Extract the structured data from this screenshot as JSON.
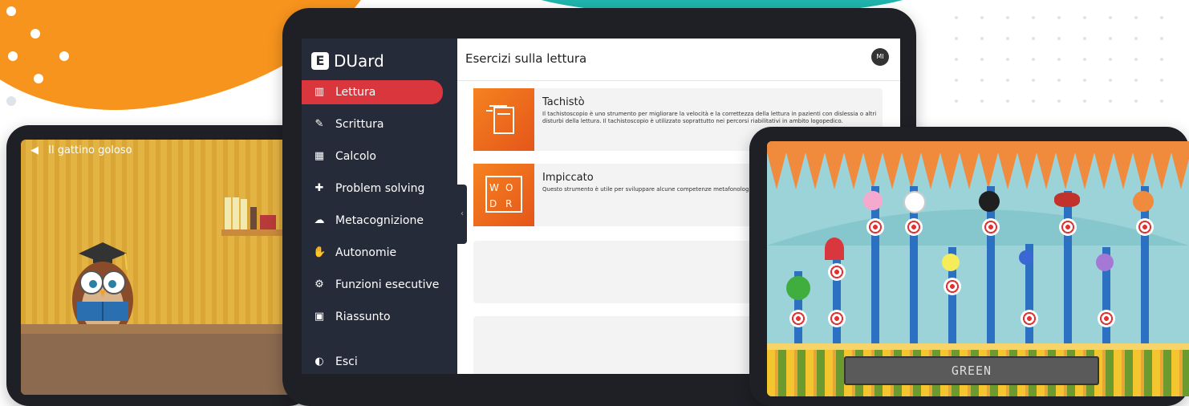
{
  "left_game": {
    "title": "Il gattino goloso",
    "back_icon": "triangle-left-icon"
  },
  "app": {
    "brand": "DUard",
    "brand_mark": "E",
    "page_title": "Esercizi sulla lettura",
    "avatar_initials": "MI",
    "accent": "#d9363e",
    "sidebar_bg": "#262b39"
  },
  "nav": [
    {
      "label": "Lettura",
      "icon": "book-open-icon",
      "active": true
    },
    {
      "label": "Scrittura",
      "icon": "pen-icon"
    },
    {
      "label": "Calcolo",
      "icon": "calculator-icon"
    },
    {
      "label": "Problem solving",
      "icon": "puzzle-icon"
    },
    {
      "label": "Metacognizione",
      "icon": "brain-icon"
    },
    {
      "label": "Autonomie",
      "icon": "hand-icon"
    },
    {
      "label": "Funzioni esecutive",
      "icon": "gears-icon"
    },
    {
      "label": "Riassunto",
      "icon": "document-search-icon"
    },
    {
      "label": "Esci",
      "icon": "exit-icon"
    }
  ],
  "cards": [
    {
      "title": "Tachistò",
      "icon": "book-speed-icon",
      "description": "Il tachistoscopio è uno strumento per migliorare la velocità e la correttezza della lettura in pazienti con dislessia o altri disturbi della lettura. Il tachistoscopio è utilizzato soprattutto nei percorsi riabilitativi in ambito logopedico."
    },
    {
      "title": "Impiccato",
      "icon": "word-puzzle-icon",
      "description": "Questo strumento è utile per sviluppare alcune competenze metafonologiche"
    }
  ],
  "right_game": {
    "answer": "GREEN"
  }
}
